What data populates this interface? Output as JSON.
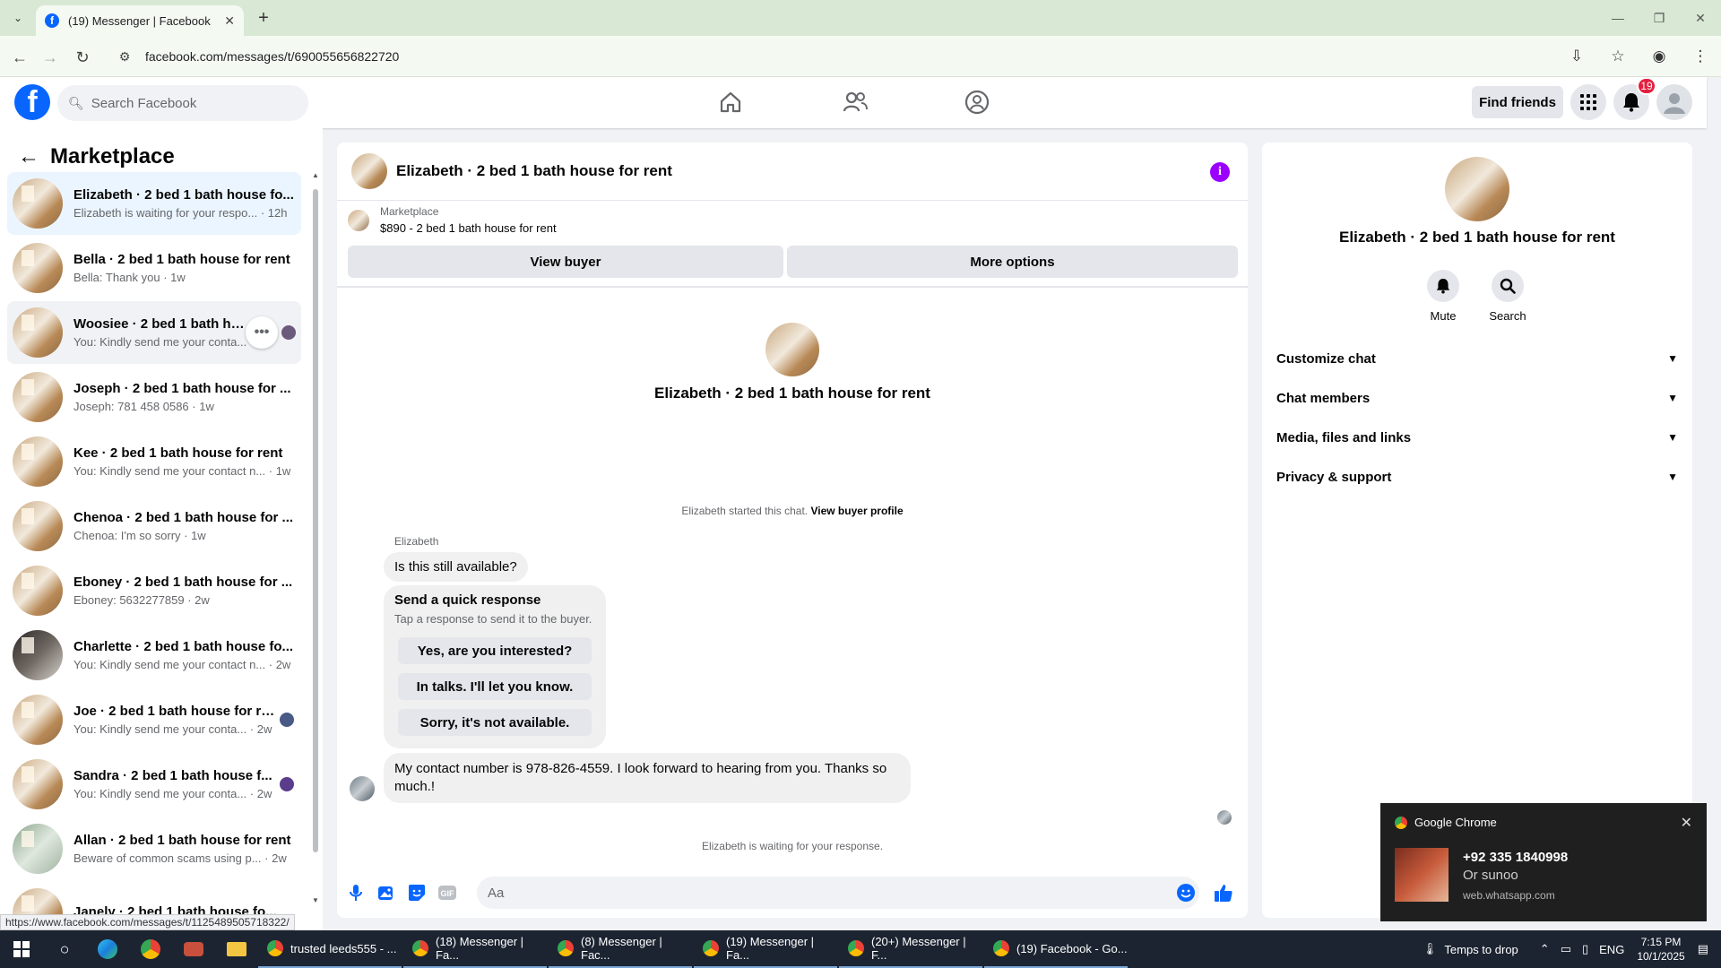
{
  "browser": {
    "tab_title": "(19) Messenger | Facebook",
    "url": "facebook.com/messages/t/690055656822720",
    "status_url": "https://www.facebook.com/messages/t/1125489505718322/"
  },
  "header": {
    "search_placeholder": "Search Facebook",
    "find_friends": "Find friends",
    "notif_count": "19"
  },
  "sidebar": {
    "title": "Marketplace",
    "conversations": [
      {
        "name": "Elizabeth · 2 bed 1 bath house fo...",
        "sub": "Elizabeth is waiting for your respo... · 12h"
      },
      {
        "name": "Bella · 2 bed 1 bath house for rent",
        "sub": "Bella: Thank you · 1w"
      },
      {
        "name": "Woosiee · 2 bed 1 bath house",
        "sub": "You: Kindly send me your conta..."
      },
      {
        "name": "Joseph · 2 bed 1 bath house for ...",
        "sub": "Joseph: 781 458 0586 · 1w"
      },
      {
        "name": "Kee · 2 bed 1 bath house for rent",
        "sub": "You: Kindly send me your contact n... · 1w"
      },
      {
        "name": "Chenoa · 2 bed 1 bath house for ...",
        "sub": "Chenoa: I'm so sorry · 1w"
      },
      {
        "name": "Eboney · 2 bed 1 bath house for ...",
        "sub": "Eboney: 5632277859 · 2w"
      },
      {
        "name": "Charlette · 2 bed 1 bath house fo...",
        "sub": "You: Kindly send me your contact n... · 2w"
      },
      {
        "name": "Joe · 2 bed 1 bath house for re...",
        "sub": "You: Kindly send me your conta... · 2w"
      },
      {
        "name": "Sandra · 2 bed 1 bath house f...",
        "sub": "You: Kindly send me your conta... · 2w"
      },
      {
        "name": "Allan · 2 bed 1 bath house for rent",
        "sub": "Beware of common scams using p... · 2w"
      },
      {
        "name": "Janely · 2 bed 1 bath house fo...",
        "sub": ""
      }
    ]
  },
  "chat": {
    "title": "Elizabeth · 2 bed 1 bath house for rent",
    "listing_label": "Marketplace",
    "listing_detail": "$890 - 2 bed 1 bath house for rent",
    "view_buyer": "View buyer",
    "more_options": "More options",
    "center_name": "Elizabeth · 2 bed 1 bath house for rent",
    "started_text": "Elizabeth started this chat.",
    "view_buyer_profile": "View buyer profile",
    "sender": "Elizabeth",
    "msg1": "Is this still available?",
    "qr_title": "Send a quick response",
    "qr_sub": "Tap a response to send it to the buyer.",
    "qr_options": [
      "Yes, are you interested?",
      "In talks. I'll let you know.",
      "Sorry, it's not available."
    ],
    "msg2": "My contact number is 978-826-4559. I look forward to hearing from you. Thanks so much.!",
    "waiting": "Elizabeth is waiting for your response.",
    "composer_placeholder": "Aa"
  },
  "details": {
    "name": "Elizabeth · 2 bed 1 bath house for rent",
    "mute": "Mute",
    "search": "Search",
    "rows": [
      "Customize chat",
      "Chat members",
      "Media, files and links",
      "Privacy & support"
    ]
  },
  "notification": {
    "app": "Google Chrome",
    "title": "+92 335 1840998",
    "body": "Or sunoo",
    "source": "web.whatsapp.com"
  },
  "taskbar": {
    "apps": [
      "trusted leeds555 - ...",
      "(18) Messenger | Fa...",
      "(8) Messenger | Fac...",
      "(19) Messenger | Fa...",
      "(20+) Messenger | F...",
      "(19) Facebook - Go..."
    ],
    "weather": "Temps to drop",
    "lang": "ENG",
    "time": "7:15 PM",
    "date": "10/1/2025"
  }
}
